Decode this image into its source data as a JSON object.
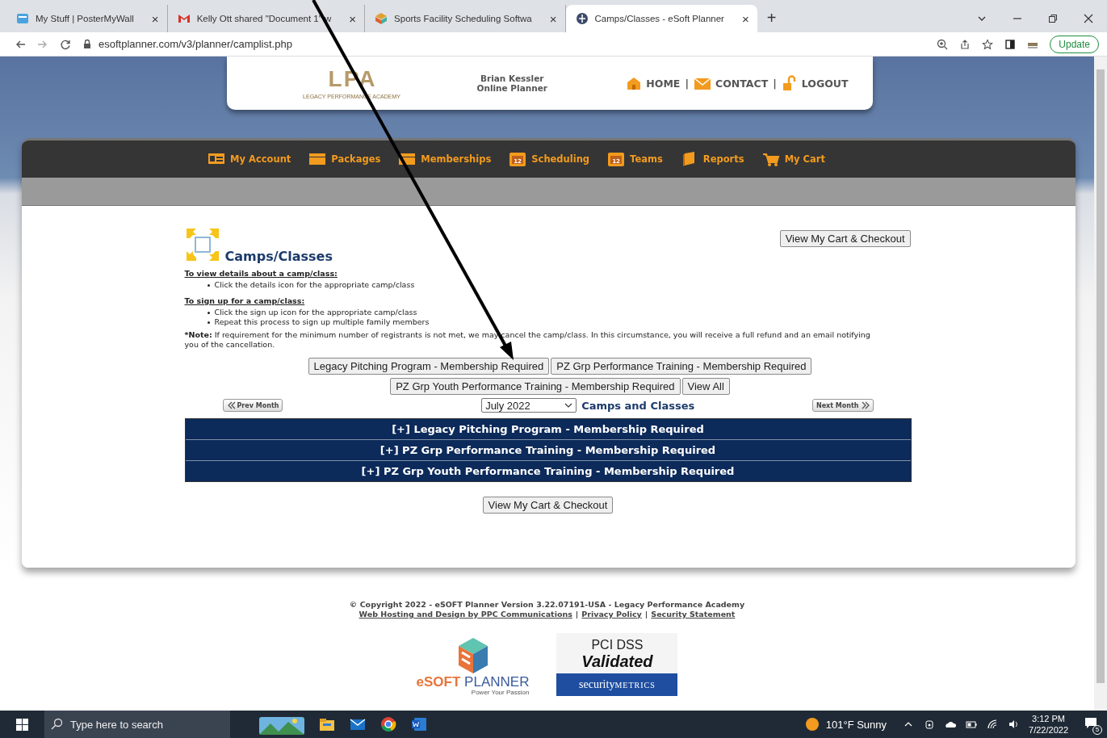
{
  "browser": {
    "tabs": [
      {
        "title": "My Stuff | PosterMyWall",
        "close": "×",
        "selected": false
      },
      {
        "title": "Kelly Ott shared \"Document 1\" w",
        "close": "×",
        "selected": false
      },
      {
        "title": "Sports Facility Scheduling Softwa",
        "close": "×",
        "selected": false
      },
      {
        "title": "Camps/Classes - eSoft Planner",
        "close": "×",
        "selected": true
      }
    ],
    "new_tab": "+",
    "url": "esoftplanner.com/v3/planner/camplist.php",
    "update_label": "Update"
  },
  "header": {
    "logo": "LPA",
    "logo_subtitle": "LEGACY PERFORMANCE ACADEMY",
    "user_name": "Brian Kessler",
    "user_role": "Online Planner",
    "links": [
      {
        "label": "HOME"
      },
      {
        "label": "CONTACT"
      },
      {
        "label": "LOGOUT"
      }
    ],
    "separator": "|"
  },
  "nav": {
    "items": [
      {
        "label": "My Account"
      },
      {
        "label": "Packages"
      },
      {
        "label": "Memberships"
      },
      {
        "label": "Scheduling",
        "badge": "12"
      },
      {
        "label": "Teams",
        "badge": "12"
      },
      {
        "label": "Reports"
      },
      {
        "label": "My Cart"
      }
    ]
  },
  "content": {
    "title": "Camps/Classes",
    "cart_button": "View My Cart & Checkout",
    "instructions": [
      {
        "heading": "To view details about a camp/class:",
        "bullets": [
          "Click the details icon for the appropriate camp/class"
        ]
      },
      {
        "heading": "To sign up for a camp/class:",
        "bullets": [
          "Click the sign up icon for the appropriate camp/class",
          "Repeat this process to sign up multiple family members"
        ]
      }
    ],
    "note": {
      "label": "*Note:",
      "text": "If requirement for the minimum number of registrants is not met, we may cancel the camp/class. In this circumstance, you will receive a full refund and an email notifying you of the cancellation."
    },
    "filter_rows": [
      [
        "Legacy Pitching Program - Membership Required",
        "PZ Grp Performance Training - Membership Required"
      ],
      [
        "PZ Grp Youth Performance Training - Membership Required",
        "View All"
      ]
    ],
    "prev_month": "Prev Month",
    "next_month": "Next Month",
    "month": "July 2022",
    "month_heading": "Camps and Classes",
    "camp_rows": [
      {
        "prefix": "[+]",
        "label": "Legacy Pitching Program - Membership Required"
      },
      {
        "prefix": "[+]",
        "label": "PZ Grp Performance Training - Membership Required"
      },
      {
        "prefix": "[+]",
        "label": "PZ Grp Youth Performance Training - Membership Required"
      }
    ],
    "bottom_cart_button": "View My Cart & Checkout"
  },
  "footer": {
    "copyright": "© Copyright 2022 - eSOFT Planner Version 3.22.07191-USA - Legacy Performance Academy",
    "links": [
      "Web Hosting and Design by PPC Communications",
      "Privacy Policy",
      "Security Statement"
    ],
    "separator": "|",
    "esoft_logo": {
      "brand_a": "eSOFT",
      "brand_b": "PLANNER",
      "tagline": "Power Your Passion"
    },
    "pci_badge": {
      "line1": "PCI DSS",
      "line2": "Validated",
      "brand_a": "security",
      "brand_b": "METRICS"
    }
  },
  "taskbar": {
    "search_placeholder": "Type here to search",
    "weather": "101°F Sunny",
    "time": "3:12 PM",
    "date": "7/22/2022",
    "notifications": "5"
  }
}
